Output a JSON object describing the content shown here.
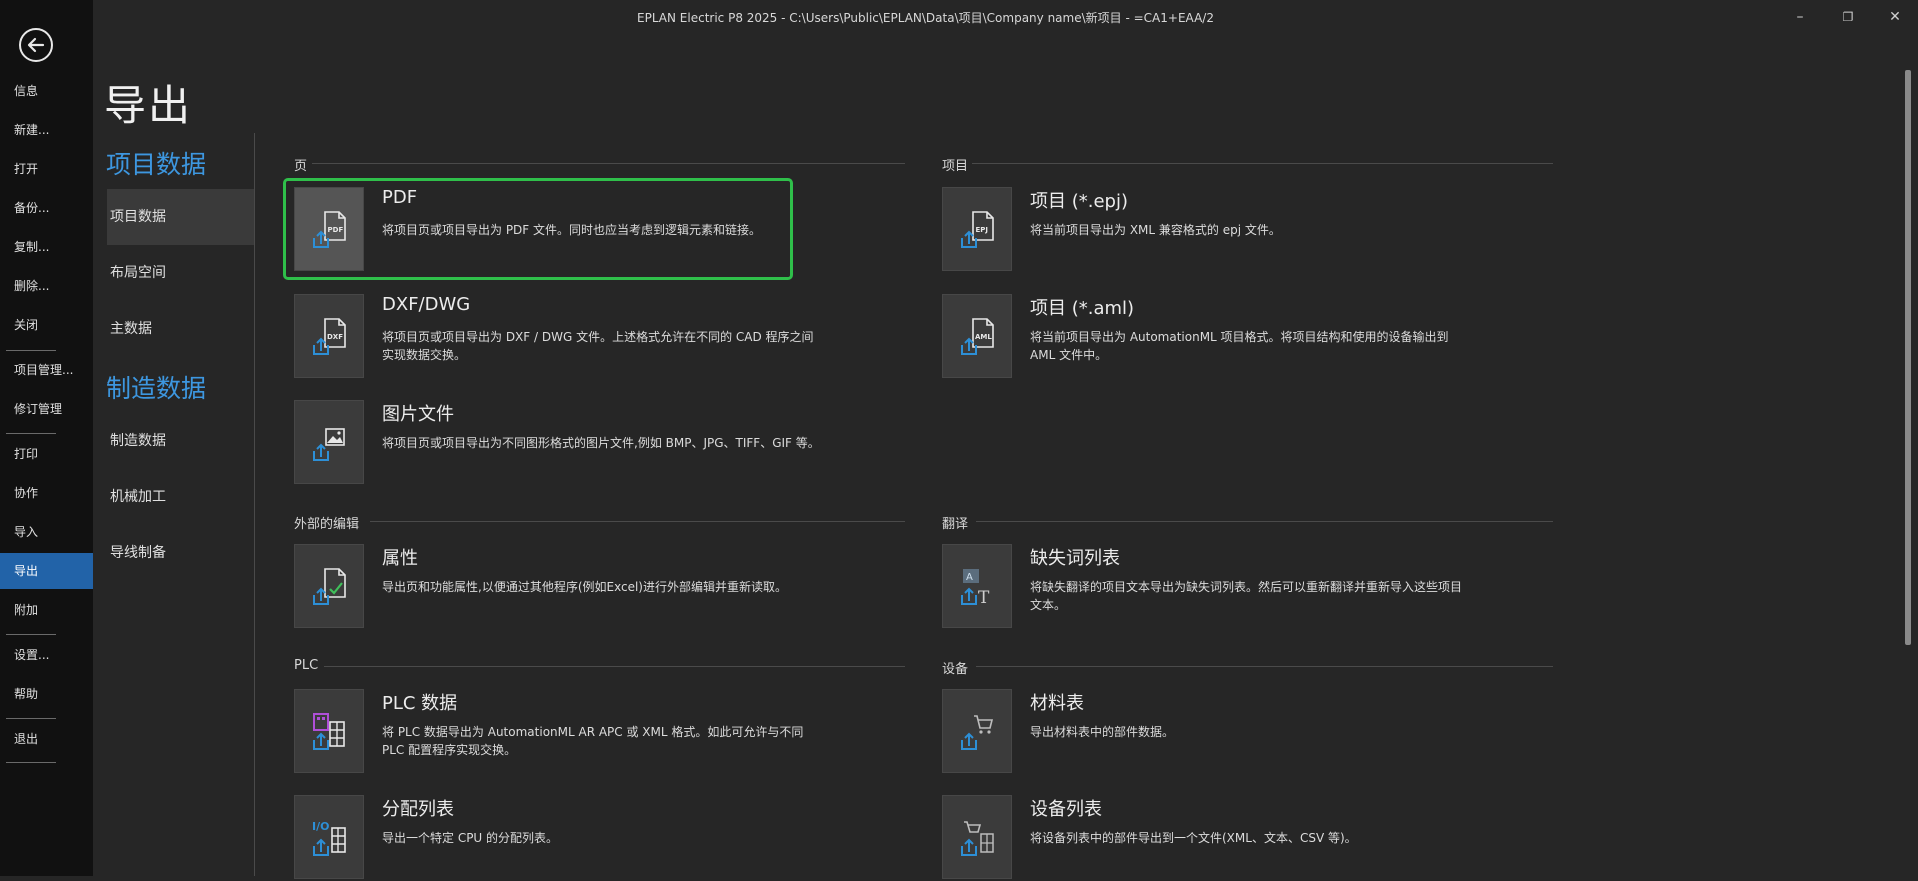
{
  "window": {
    "title": "EPLAN Electric P8 2025 - C:\\Users\\Public\\EPLAN\\Data\\项目\\Company name\\新项目 - =CA1+EAA/2",
    "minimize": "–",
    "restore": "❐",
    "close": "✕"
  },
  "rail": {
    "items": [
      {
        "label": "信息"
      },
      {
        "label": "新建..."
      },
      {
        "label": "打开"
      },
      {
        "label": "备份..."
      },
      {
        "label": "复制..."
      },
      {
        "label": "删除..."
      },
      {
        "label": "关闭"
      },
      {
        "label": "项目管理..."
      },
      {
        "label": "修订管理"
      },
      {
        "label": "打印"
      },
      {
        "label": "协作"
      },
      {
        "label": "导入"
      },
      {
        "label": "导出",
        "active": true
      },
      {
        "label": "附加"
      },
      {
        "label": "设置..."
      },
      {
        "label": "帮助"
      },
      {
        "label": "退出"
      }
    ]
  },
  "page": {
    "title": "导出"
  },
  "nav": {
    "cat1": "项目数据",
    "cat1_items": [
      "项目数据",
      "布局空间",
      "主数据"
    ],
    "cat2": "制造数据",
    "cat2_items": [
      "制造数据",
      "机械加工",
      "导线制备"
    ]
  },
  "sections": {
    "page": "页",
    "project": "项目",
    "external": "外部的编辑",
    "translate": "翻译",
    "plc": "PLC",
    "device": "设备"
  },
  "tiles": {
    "pdf": {
      "name": "PDF",
      "desc": "将项目页或项目导出为 PDF 文件。同时也应当考虑到逻辑元素和链接。",
      "icon": "pdf-export-icon"
    },
    "dxf": {
      "name": "DXF/DWG",
      "desc": "将项目页或项目导出为 DXF / DWG 文件。上述格式允许在不同的 CAD 程序之间实现数据交换。",
      "icon": "dxf-export-icon"
    },
    "image": {
      "name": "图片文件",
      "desc": "将项目页或项目导出为不同图形格式的图片文件,例如 BMP、JPG、TIFF、GIF 等。",
      "icon": "image-export-icon"
    },
    "epj": {
      "name": "项目 (*.epj)",
      "desc": "将当前项目导出为 XML 兼容格式的 epj 文件。",
      "icon": "epj-export-icon"
    },
    "aml": {
      "name": "项目 (*.aml)",
      "desc": "将当前项目导出为 AutomationML 项目格式。将项目结构和使用的设备输出到 AML 文件中。",
      "icon": "aml-export-icon"
    },
    "props": {
      "name": "属性",
      "desc": "导出页和功能属性,以便通过其他程序(例如Excel)进行外部编辑并重新读取。",
      "icon": "properties-export-icon"
    },
    "missing": {
      "name": "缺失词列表",
      "desc": "将缺失翻译的项目文本导出为缺失词列表。然后可以重新翻译并重新导入这些项目文本。",
      "icon": "missing-words-export-icon"
    },
    "plcdata": {
      "name": "PLC 数据",
      "desc": "将 PLC 数据导出为 AutomationML AR APC 或 XML 格式。如此可允许与不同 PLC 配置程序实现交换。",
      "icon": "plc-data-export-icon"
    },
    "bom": {
      "name": "材料表",
      "desc": "导出材料表中的部件数据。",
      "icon": "bom-export-icon"
    },
    "assign": {
      "name": "分配列表",
      "desc": "导出一个特定 CPU 的分配列表。",
      "icon": "assignment-list-export-icon"
    },
    "devlist": {
      "name": "设备列表",
      "desc": "将设备列表中的部件导出到一个文件(XML、文本、CSV 等)。",
      "icon": "device-list-export-icon"
    }
  },
  "colors": {
    "accent": "#3d97e0",
    "active_rail": "#2263a8",
    "selection": "#2fbf4a",
    "export_arrow": "#2d8fd6"
  }
}
